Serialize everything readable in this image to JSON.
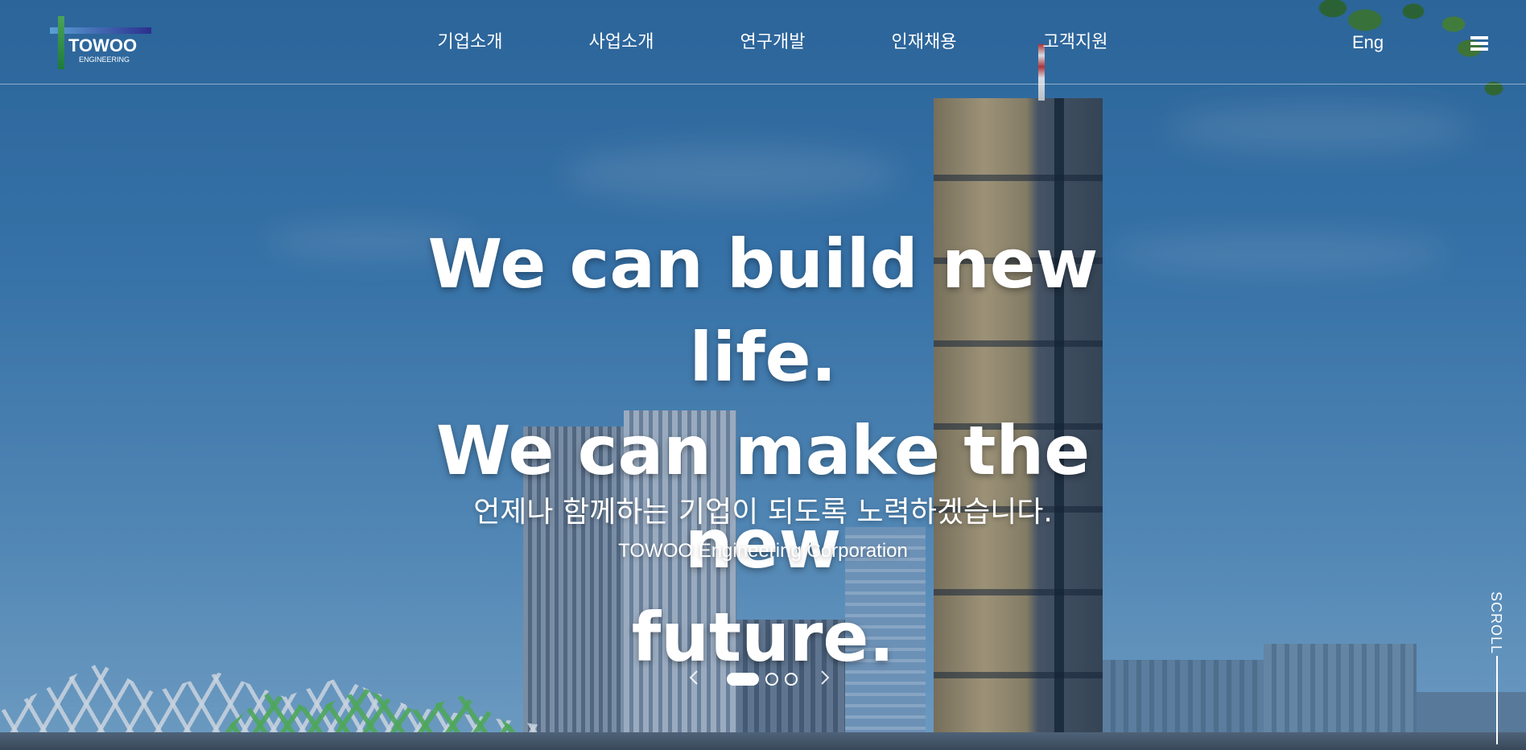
{
  "header": {
    "logo": {
      "wordmark": "TOWOO",
      "subtitle": "ENGINEERING"
    },
    "nav": [
      {
        "label": "기업소개"
      },
      {
        "label": "사업소개"
      },
      {
        "label": "연구개발"
      },
      {
        "label": "인재채용"
      },
      {
        "label": "고객지원"
      }
    ],
    "language_label": "Eng",
    "menu_icon": "hamburger-menu-icon"
  },
  "hero": {
    "headline": [
      "We can build new life.",
      "We can make the new",
      "future."
    ],
    "tagline_ko": "언제나 함께하는 기업이 되도록 노력하겠습니다.",
    "company": "TOWOO Engineering Corporation"
  },
  "slider": {
    "prev_icon": "chevron-left-icon",
    "next_icon": "chevron-right-icon",
    "slide_count": 3,
    "active_index": 1
  },
  "scroll_indicator": {
    "label": "SCROLL"
  },
  "colors": {
    "text": "#ffffff",
    "logo_green": "#2e8b46",
    "logo_blue": "#2b2f8c",
    "sky": "#3c7db6"
  }
}
